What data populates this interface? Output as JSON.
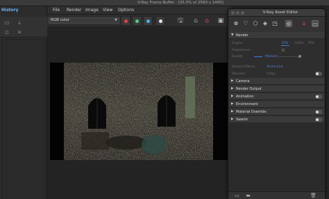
{
  "frame_buffer": {
    "title": "V-Ray Frame Buffer - [35.0% of 2560 x 1440]",
    "menu": [
      "File",
      "Render",
      "Image",
      "View",
      "Options"
    ],
    "channel": "RGB color"
  },
  "history": {
    "tab_label": "History"
  },
  "colors": {
    "red_dot": "#e0434c",
    "green_dot": "#4cd07a",
    "blue_dot": "#4ab0ff",
    "accent": "#3a7be0"
  },
  "asset_editor": {
    "title": "V-Ray Asset Editor",
    "render_section": {
      "label": "Render",
      "engine_label": "Engine",
      "engine_options": [
        "CPU",
        "CUDA",
        "RTX"
      ],
      "engine_selected": "CPU",
      "progressive_label": "Progressive",
      "quality_label": "Quality",
      "quality_value": "Medium",
      "volume_label": "Volume Effects",
      "volume_value": "At the End",
      "denoiser_label": "Denoiser",
      "denoiser_value": "V-Ray"
    },
    "sections": [
      {
        "label": "Camera",
        "toggle": false
      },
      {
        "label": "Render Output",
        "toggle": false
      },
      {
        "label": "Animation",
        "toggle": true,
        "on": false
      },
      {
        "label": "Environment",
        "toggle": false
      },
      {
        "label": "Material Override",
        "toggle": true,
        "on": false
      },
      {
        "label": "Swarm",
        "toggle": true,
        "on": false
      }
    ]
  }
}
